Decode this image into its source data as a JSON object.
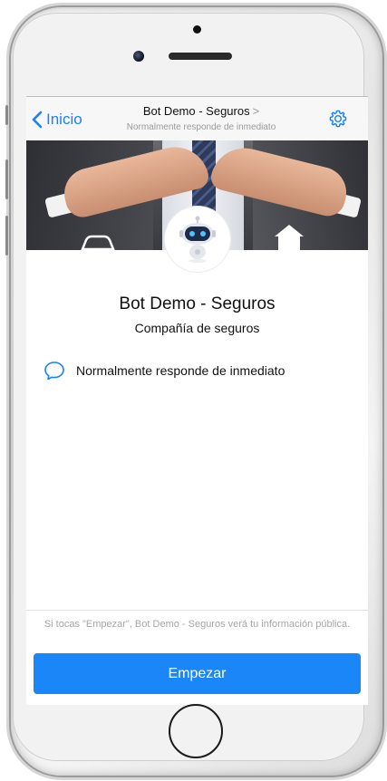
{
  "nav": {
    "back_label": "Inicio",
    "title": "Bot Demo - Seguros",
    "title_chevron": ">",
    "subtitle": "Normalmente responde de inmediato"
  },
  "profile": {
    "name": "Bot Demo - Seguros",
    "category": "Compañía de seguros",
    "response_info": "Normalmente responde de inmediato"
  },
  "footer": {
    "disclaimer": "Si tocas \"Empezar\", Bot Demo - Seguros verá tu información pública.",
    "start_button_label": "Empezar"
  },
  "icons": {
    "back": "chevron-left-icon",
    "settings": "gear-icon",
    "response": "chat-bubble-icon",
    "avatar": "robot-icon",
    "home": "home-button"
  },
  "colors": {
    "accent": "#1b86f7",
    "nav_background": "#f7f7f8",
    "muted_text": "#9a9a9a"
  }
}
